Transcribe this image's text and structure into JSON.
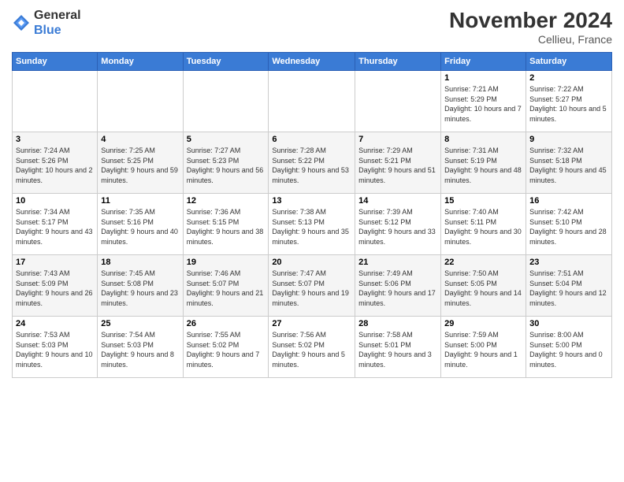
{
  "logo": {
    "general": "General",
    "blue": "Blue"
  },
  "title": "November 2024",
  "subtitle": "Cellieu, France",
  "days_header": [
    "Sunday",
    "Monday",
    "Tuesday",
    "Wednesday",
    "Thursday",
    "Friday",
    "Saturday"
  ],
  "weeks": [
    [
      {
        "day": "",
        "sunrise": "",
        "sunset": "",
        "daylight": ""
      },
      {
        "day": "",
        "sunrise": "",
        "sunset": "",
        "daylight": ""
      },
      {
        "day": "",
        "sunrise": "",
        "sunset": "",
        "daylight": ""
      },
      {
        "day": "",
        "sunrise": "",
        "sunset": "",
        "daylight": ""
      },
      {
        "day": "",
        "sunrise": "",
        "sunset": "",
        "daylight": ""
      },
      {
        "day": "1",
        "sunrise": "Sunrise: 7:21 AM",
        "sunset": "Sunset: 5:29 PM",
        "daylight": "Daylight: 10 hours and 7 minutes."
      },
      {
        "day": "2",
        "sunrise": "Sunrise: 7:22 AM",
        "sunset": "Sunset: 5:27 PM",
        "daylight": "Daylight: 10 hours and 5 minutes."
      }
    ],
    [
      {
        "day": "3",
        "sunrise": "Sunrise: 7:24 AM",
        "sunset": "Sunset: 5:26 PM",
        "daylight": "Daylight: 10 hours and 2 minutes."
      },
      {
        "day": "4",
        "sunrise": "Sunrise: 7:25 AM",
        "sunset": "Sunset: 5:25 PM",
        "daylight": "Daylight: 9 hours and 59 minutes."
      },
      {
        "day": "5",
        "sunrise": "Sunrise: 7:27 AM",
        "sunset": "Sunset: 5:23 PM",
        "daylight": "Daylight: 9 hours and 56 minutes."
      },
      {
        "day": "6",
        "sunrise": "Sunrise: 7:28 AM",
        "sunset": "Sunset: 5:22 PM",
        "daylight": "Daylight: 9 hours and 53 minutes."
      },
      {
        "day": "7",
        "sunrise": "Sunrise: 7:29 AM",
        "sunset": "Sunset: 5:21 PM",
        "daylight": "Daylight: 9 hours and 51 minutes."
      },
      {
        "day": "8",
        "sunrise": "Sunrise: 7:31 AM",
        "sunset": "Sunset: 5:19 PM",
        "daylight": "Daylight: 9 hours and 48 minutes."
      },
      {
        "day": "9",
        "sunrise": "Sunrise: 7:32 AM",
        "sunset": "Sunset: 5:18 PM",
        "daylight": "Daylight: 9 hours and 45 minutes."
      }
    ],
    [
      {
        "day": "10",
        "sunrise": "Sunrise: 7:34 AM",
        "sunset": "Sunset: 5:17 PM",
        "daylight": "Daylight: 9 hours and 43 minutes."
      },
      {
        "day": "11",
        "sunrise": "Sunrise: 7:35 AM",
        "sunset": "Sunset: 5:16 PM",
        "daylight": "Daylight: 9 hours and 40 minutes."
      },
      {
        "day": "12",
        "sunrise": "Sunrise: 7:36 AM",
        "sunset": "Sunset: 5:15 PM",
        "daylight": "Daylight: 9 hours and 38 minutes."
      },
      {
        "day": "13",
        "sunrise": "Sunrise: 7:38 AM",
        "sunset": "Sunset: 5:13 PM",
        "daylight": "Daylight: 9 hours and 35 minutes."
      },
      {
        "day": "14",
        "sunrise": "Sunrise: 7:39 AM",
        "sunset": "Sunset: 5:12 PM",
        "daylight": "Daylight: 9 hours and 33 minutes."
      },
      {
        "day": "15",
        "sunrise": "Sunrise: 7:40 AM",
        "sunset": "Sunset: 5:11 PM",
        "daylight": "Daylight: 9 hours and 30 minutes."
      },
      {
        "day": "16",
        "sunrise": "Sunrise: 7:42 AM",
        "sunset": "Sunset: 5:10 PM",
        "daylight": "Daylight: 9 hours and 28 minutes."
      }
    ],
    [
      {
        "day": "17",
        "sunrise": "Sunrise: 7:43 AM",
        "sunset": "Sunset: 5:09 PM",
        "daylight": "Daylight: 9 hours and 26 minutes."
      },
      {
        "day": "18",
        "sunrise": "Sunrise: 7:45 AM",
        "sunset": "Sunset: 5:08 PM",
        "daylight": "Daylight: 9 hours and 23 minutes."
      },
      {
        "day": "19",
        "sunrise": "Sunrise: 7:46 AM",
        "sunset": "Sunset: 5:07 PM",
        "daylight": "Daylight: 9 hours and 21 minutes."
      },
      {
        "day": "20",
        "sunrise": "Sunrise: 7:47 AM",
        "sunset": "Sunset: 5:07 PM",
        "daylight": "Daylight: 9 hours and 19 minutes."
      },
      {
        "day": "21",
        "sunrise": "Sunrise: 7:49 AM",
        "sunset": "Sunset: 5:06 PM",
        "daylight": "Daylight: 9 hours and 17 minutes."
      },
      {
        "day": "22",
        "sunrise": "Sunrise: 7:50 AM",
        "sunset": "Sunset: 5:05 PM",
        "daylight": "Daylight: 9 hours and 14 minutes."
      },
      {
        "day": "23",
        "sunrise": "Sunrise: 7:51 AM",
        "sunset": "Sunset: 5:04 PM",
        "daylight": "Daylight: 9 hours and 12 minutes."
      }
    ],
    [
      {
        "day": "24",
        "sunrise": "Sunrise: 7:53 AM",
        "sunset": "Sunset: 5:03 PM",
        "daylight": "Daylight: 9 hours and 10 minutes."
      },
      {
        "day": "25",
        "sunrise": "Sunrise: 7:54 AM",
        "sunset": "Sunset: 5:03 PM",
        "daylight": "Daylight: 9 hours and 8 minutes."
      },
      {
        "day": "26",
        "sunrise": "Sunrise: 7:55 AM",
        "sunset": "Sunset: 5:02 PM",
        "daylight": "Daylight: 9 hours and 7 minutes."
      },
      {
        "day": "27",
        "sunrise": "Sunrise: 7:56 AM",
        "sunset": "Sunset: 5:02 PM",
        "daylight": "Daylight: 9 hours and 5 minutes."
      },
      {
        "day": "28",
        "sunrise": "Sunrise: 7:58 AM",
        "sunset": "Sunset: 5:01 PM",
        "daylight": "Daylight: 9 hours and 3 minutes."
      },
      {
        "day": "29",
        "sunrise": "Sunrise: 7:59 AM",
        "sunset": "Sunset: 5:00 PM",
        "daylight": "Daylight: 9 hours and 1 minute."
      },
      {
        "day": "30",
        "sunrise": "Sunrise: 8:00 AM",
        "sunset": "Sunset: 5:00 PM",
        "daylight": "Daylight: 9 hours and 0 minutes."
      }
    ]
  ]
}
